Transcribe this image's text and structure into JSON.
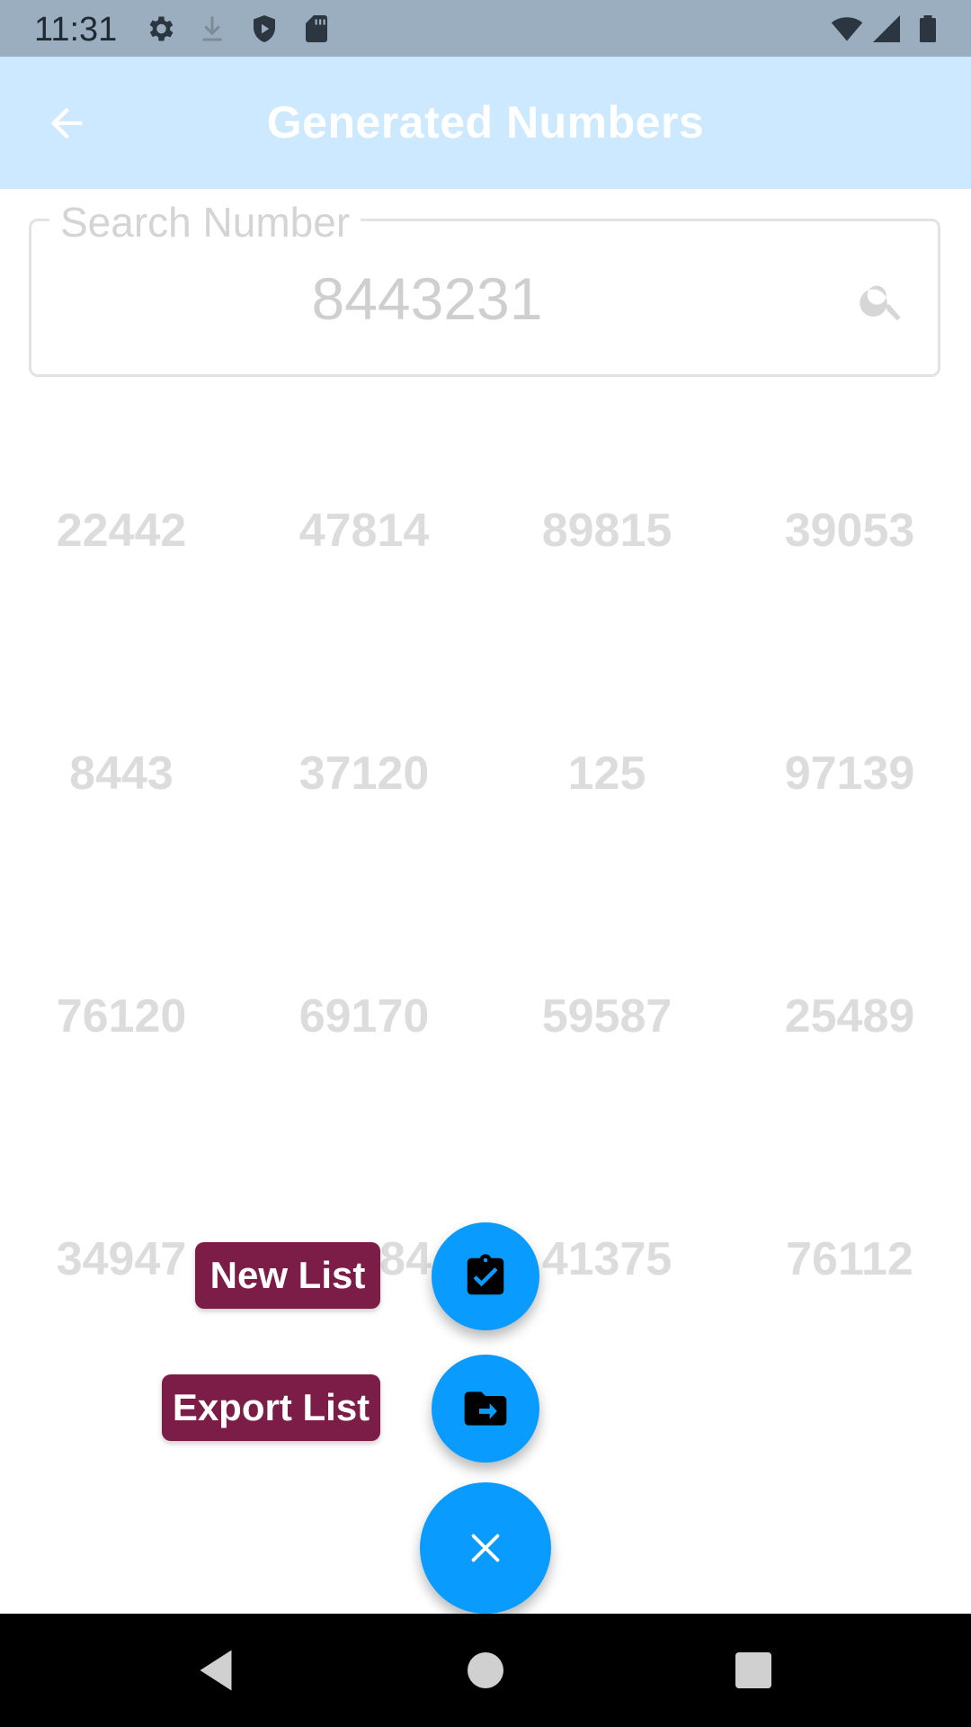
{
  "status_bar": {
    "time": "11:31",
    "icons": [
      "settings-icon",
      "download-icon",
      "shield-icon",
      "sd-card-icon",
      "wifi-icon",
      "signal-icon",
      "battery-icon"
    ]
  },
  "app_bar": {
    "title": "Generated Numbers",
    "back_icon": "arrow-back-icon",
    "background": "#cce9ff"
  },
  "search": {
    "label": "Search Number",
    "value": "8443231",
    "icon": "search-icon"
  },
  "numbers": [
    [
      "22442",
      "47814",
      "89815",
      "39053"
    ],
    [
      "8443",
      "37120",
      "125",
      "97139"
    ],
    [
      "76120",
      "69170",
      "59587",
      "25489"
    ],
    [
      "34947",
      "84",
      "41375",
      "76112"
    ]
  ],
  "fab_menu": {
    "new_list_label": "New List",
    "new_list_icon": "clipboard-check-icon",
    "export_list_label": "Export List",
    "export_list_icon": "folder-export-icon",
    "close_icon": "close-icon",
    "fab_color": "#0a9bff",
    "label_color": "#7b1d47"
  },
  "nav_bar": {
    "icons": [
      "back-triangle-icon",
      "home-circle-icon",
      "recents-square-icon"
    ]
  }
}
